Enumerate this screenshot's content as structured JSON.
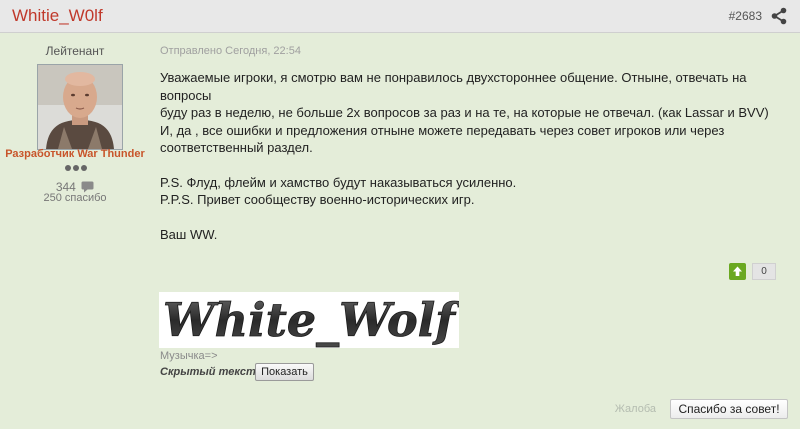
{
  "post": {
    "author": "Whitie_W0lf",
    "number": "#2683",
    "posted": "Отправлено Сегодня, 22:54",
    "body": [
      "Уважаемые игроки, я смотрю вам не понравилось двухстороннее общение. Отныне, отвечать на вопросы",
      "буду раз в неделю, не больше 2х вопросов за раз и на те, на которые не отвечал. (как Lassar и BVV)",
      "И, да , все ошибки и предложения отныне можете передавать через совет игроков или через",
      "соответственный раздел.",
      "P.S. Флуд, флейм и хамство будут наказываться усиленно.",
      "P.P.S. Привет сообществу военно-исторических игр.",
      "Ваш WW."
    ],
    "like_count": "0"
  },
  "author_info": {
    "rank": "Лейтенант",
    "title": "Разработчик War Thunder",
    "post_count": "344",
    "thanks": "250 спасибо"
  },
  "signature": {
    "banner_text": "White_Wolf",
    "music_label": "Музычка=>",
    "hidden_label": "Скрытый текст",
    "show_button": "Показать"
  },
  "footer": {
    "report": "Жалоба",
    "thanks_button": "Спасибо за совет!"
  },
  "colors": {
    "background": "#e4edd9",
    "author_name": "#c0392b",
    "dev_title": "#c8552a",
    "like_button": "#6aa820"
  },
  "icons": [
    "share-icon",
    "comment-icon",
    "arrow-up-icon"
  ]
}
